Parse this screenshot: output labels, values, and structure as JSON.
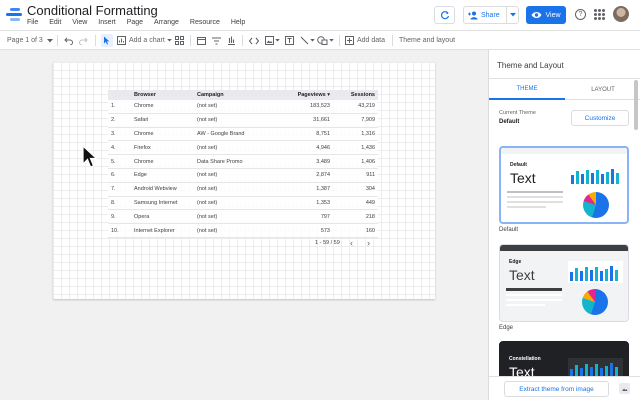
{
  "header": {
    "title": "Conditional Formatting",
    "menu": [
      "File",
      "Edit",
      "View",
      "Insert",
      "Page",
      "Arrange",
      "Resource",
      "Help"
    ],
    "share_label": "Share",
    "view_label": "View",
    "help_glyph": "?"
  },
  "toolbar": {
    "page_label": "Page 1 of 3",
    "add_chart_label": "Add a chart",
    "add_data_label": "Add data",
    "theme_layout_label": "Theme and layout"
  },
  "table": {
    "headers": [
      "",
      "Browser",
      "Campaign",
      "Pageviews ▾",
      "Sessions"
    ],
    "rows": [
      [
        "1.",
        "Chrome",
        "(not set)",
        "183,523",
        "43,219"
      ],
      [
        "2.",
        "Safari",
        "(not set)",
        "31,661",
        "7,909"
      ],
      [
        "3.",
        "Chrome",
        "AW - Google Brand",
        "8,751",
        "1,316"
      ],
      [
        "4.",
        "Firefox",
        "(not set)",
        "4,946",
        "1,436"
      ],
      [
        "5.",
        "Chrome",
        "Data Share Promo",
        "3,489",
        "1,406"
      ],
      [
        "6.",
        "Edge",
        "(not set)",
        "2,874",
        "911"
      ],
      [
        "7.",
        "Android Webview",
        "(not set)",
        "1,387",
        "304"
      ],
      [
        "8.",
        "Samsung Internet",
        "(not set)",
        "1,353",
        "449"
      ],
      [
        "9.",
        "Opera",
        "(not set)",
        "797",
        "218"
      ],
      [
        "10.",
        "Internet Explorer",
        "(not set)",
        "573",
        "160"
      ]
    ],
    "pagination": "1 - 59 / 59"
  },
  "panel": {
    "title": "Theme and Layout",
    "tabs": [
      "THEME",
      "LAYOUT"
    ],
    "current_theme_label": "Current Theme",
    "current_theme_value": "Default",
    "customize_label": "Customize",
    "themes": [
      {
        "name": "Default",
        "preview_small": "Default",
        "preview_big": "Text"
      },
      {
        "name": "Edge",
        "preview_small": "Edge",
        "preview_big": "Text"
      },
      {
        "name": "Constellation",
        "preview_small": "Constellation",
        "preview_big": "Text"
      }
    ],
    "extract_label": "Extract theme from image"
  },
  "colors": {
    "accent": "#1a73e8",
    "bar_blue": "#1a73e8",
    "bar_teal": "#12b5cb"
  }
}
